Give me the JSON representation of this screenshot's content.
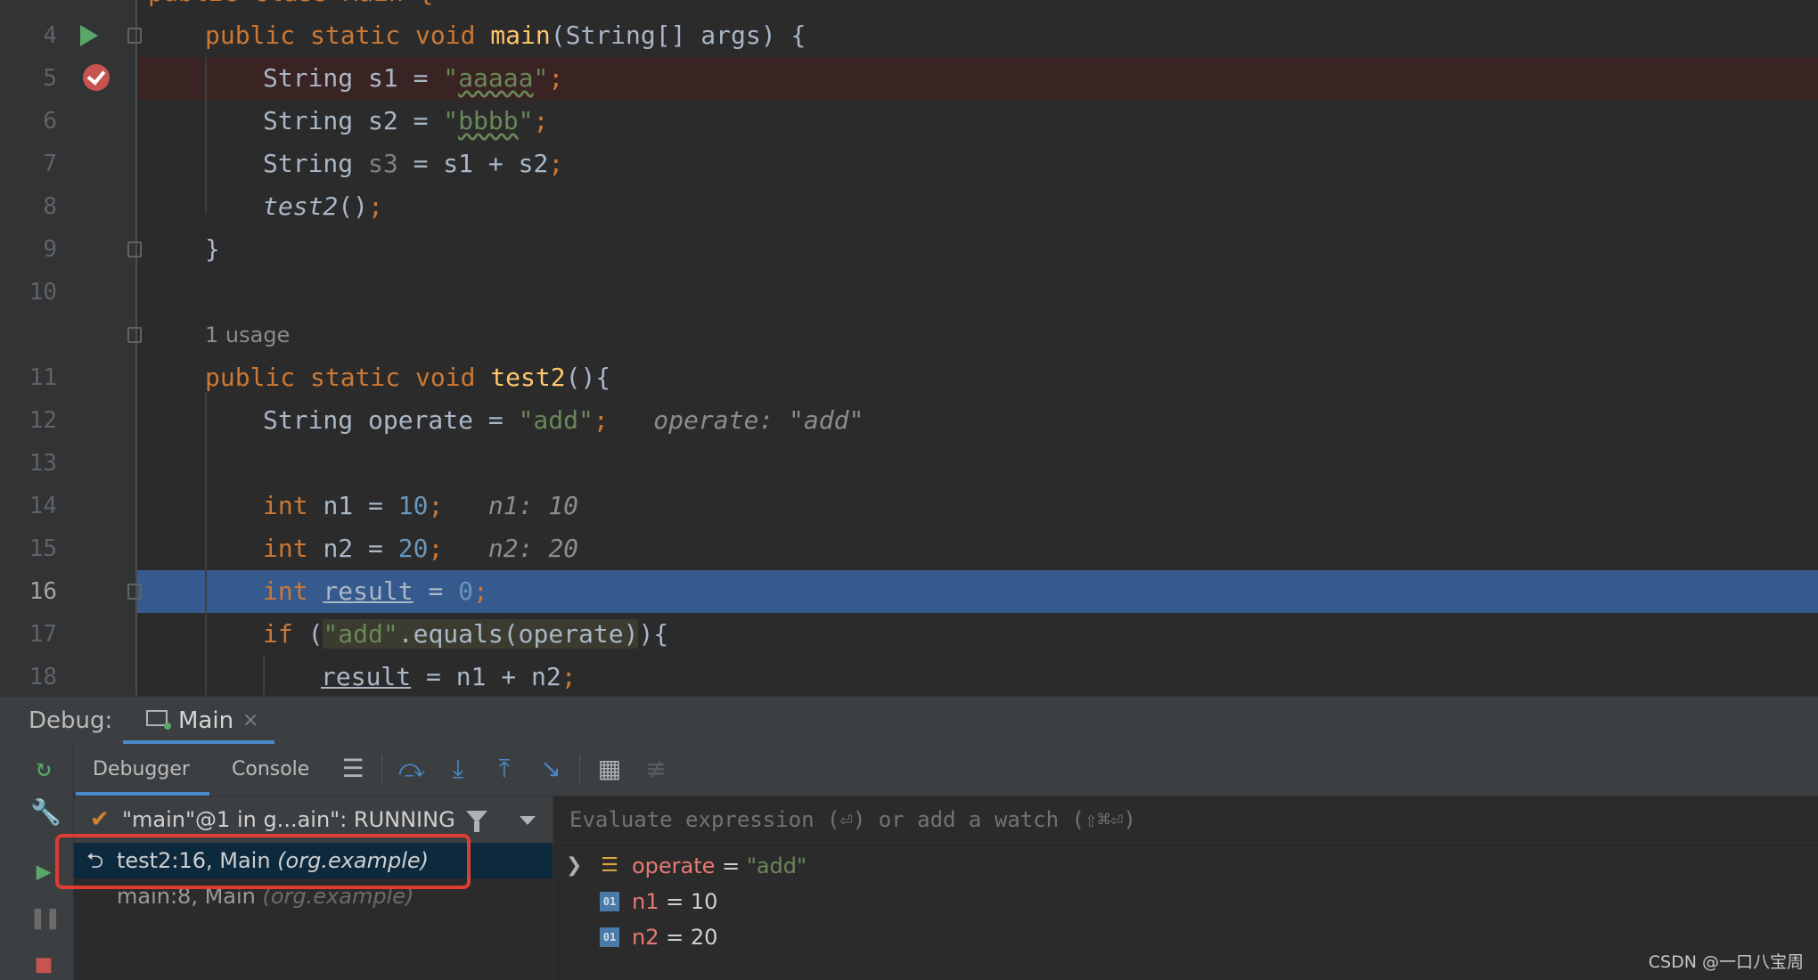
{
  "editor": {
    "lines": [
      {
        "no": "4",
        "code": [
          [
            "k",
            "public static void "
          ],
          [
            "fn",
            "main"
          ],
          [
            "",
            "(String[] args) {"
          ]
        ]
      },
      {
        "no": "5",
        "code": [
          [
            "",
            "String s1 = "
          ],
          [
            "s",
            "\""
          ],
          [
            "sw",
            "aaaaa"
          ],
          [
            "s",
            "\""
          ],
          [
            "k",
            ";"
          ]
        ]
      },
      {
        "no": "6",
        "code": [
          [
            "",
            "String s2 = "
          ],
          [
            "s",
            "\""
          ],
          [
            "sw",
            "bbbb"
          ],
          [
            "s",
            "\""
          ],
          [
            "k",
            ";"
          ]
        ]
      },
      {
        "no": "7",
        "code": [
          [
            "",
            "String "
          ],
          [
            "gray",
            "s3"
          ],
          [
            "",
            " = s1 + s2"
          ],
          [
            "k",
            ";"
          ]
        ]
      },
      {
        "no": "8",
        "code": [
          [
            "i",
            "test2"
          ],
          [
            "",
            "()"
          ],
          [
            "k",
            ";"
          ]
        ]
      },
      {
        "no": "9",
        "code": [
          [
            "",
            "}"
          ]
        ]
      },
      {
        "no": "10",
        "code": []
      },
      {
        "no": "11",
        "code": [
          [
            "k",
            "public static void "
          ],
          [
            "fn",
            "test2"
          ],
          [
            "",
            "(){"
          ]
        ]
      },
      {
        "no": "12",
        "code": [
          [
            "",
            "String operate = "
          ],
          [
            "s",
            "\"add\""
          ],
          [
            "k",
            ";"
          ],
          [
            "hint",
            "   operate: \"add\""
          ]
        ]
      },
      {
        "no": "13",
        "code": []
      },
      {
        "no": "14",
        "code": [
          [
            "k",
            "int "
          ],
          [
            "",
            "n1 = "
          ],
          [
            "n",
            "10"
          ],
          [
            "k",
            ";"
          ],
          [
            "hint",
            "   n1: 10"
          ]
        ]
      },
      {
        "no": "15",
        "code": [
          [
            "k",
            "int "
          ],
          [
            "",
            "n2 = "
          ],
          [
            "n",
            "20"
          ],
          [
            "k",
            ";"
          ],
          [
            "hint",
            "   n2: 20"
          ]
        ]
      },
      {
        "no": "16",
        "code": [
          [
            "k",
            "int "
          ],
          [
            "u",
            "result"
          ],
          [
            "",
            " = "
          ],
          [
            "n",
            "0"
          ],
          [
            "k",
            ";"
          ]
        ]
      },
      {
        "no": "17",
        "code": [
          [
            "k",
            "if "
          ],
          [
            "",
            "("
          ],
          [
            "hls",
            "\"add\""
          ],
          [
            "hl",
            ".equals(operate)"
          ],
          [
            "",
            "){"
          ]
        ]
      },
      {
        "no": "18",
        "code": [
          [
            "u",
            "result"
          ],
          [
            "",
            " = n1 + n2"
          ],
          [
            "k",
            ";"
          ]
        ]
      }
    ],
    "usage_hint": "1 usage",
    "top_partial": "public class Main {"
  },
  "debug": {
    "label": "Debug:",
    "tab_label": "Main",
    "tab_close": "×",
    "tabs": {
      "debugger": "Debugger",
      "console": "Console"
    },
    "thread": {
      "label": "\"main\"@1 in g...ain\": RUNNING"
    },
    "frames": [
      {
        "label": "test2:16, Main ",
        "pkg": "(org.example)",
        "icon": "⮌"
      },
      {
        "label": "main:8, Main ",
        "pkg": "(org.example)",
        "icon": ""
      }
    ],
    "eval_placeholder": "Evaluate expression (⏎) or add a watch (⇧⌘⏎)",
    "variables": [
      {
        "name": "operate",
        "value": "\"add\"",
        "kind": "list",
        "expandable": true,
        "icon": "☰"
      },
      {
        "name": "n1",
        "value": "10",
        "kind": "prim",
        "expandable": false,
        "icon": "01"
      },
      {
        "name": "n2",
        "value": "20",
        "kind": "prim",
        "expandable": false,
        "icon": "01"
      }
    ]
  },
  "watermark": "CSDN @一口八宝周",
  "colors": {
    "current_line": "#365a8e",
    "breakpoint_line": "#3a2323",
    "accent": "#4a88c7",
    "highlight_box": "#e03c31"
  }
}
